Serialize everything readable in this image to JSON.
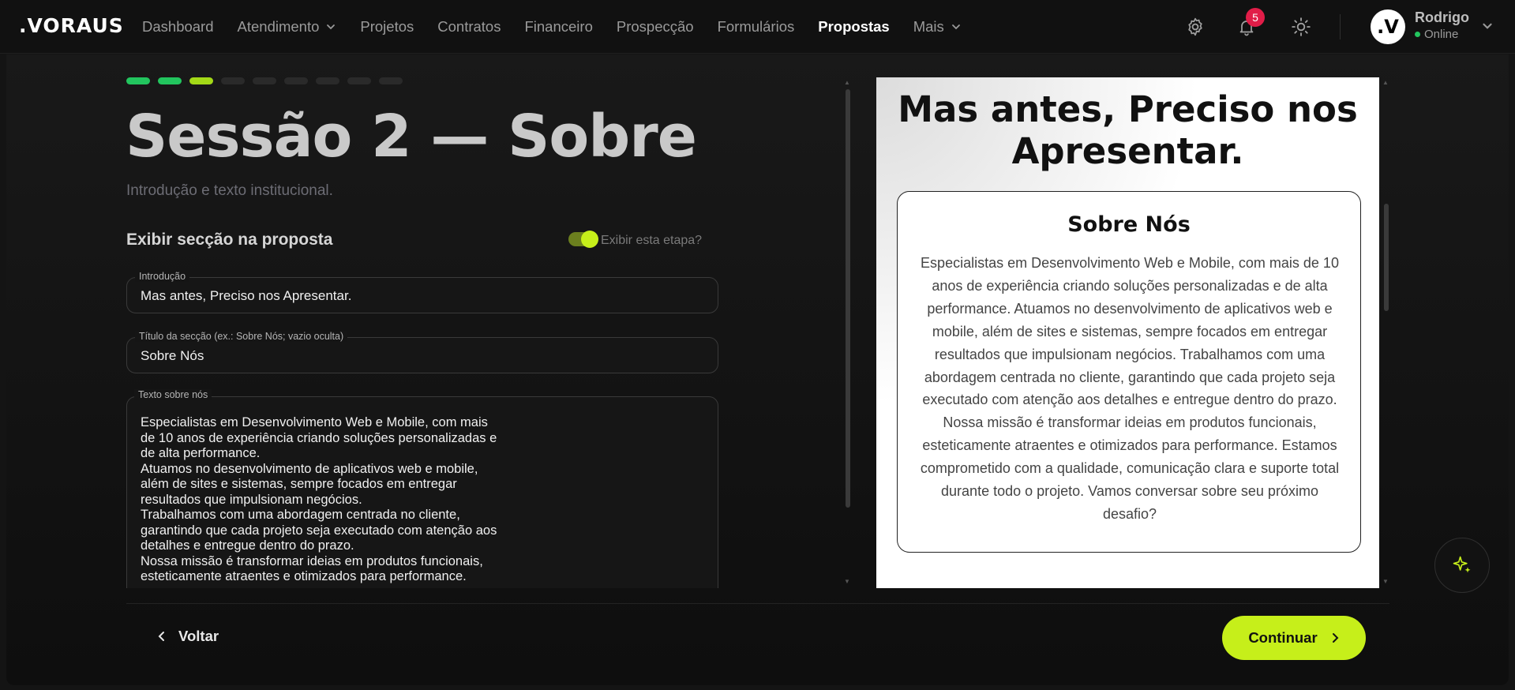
{
  "app": {
    "logo": ".VORAUS"
  },
  "nav": {
    "items": [
      {
        "label": "Dashboard",
        "dropdown": false,
        "active": false
      },
      {
        "label": "Atendimento",
        "dropdown": true,
        "active": false
      },
      {
        "label": "Projetos",
        "dropdown": false,
        "active": false
      },
      {
        "label": "Contratos",
        "dropdown": false,
        "active": false
      },
      {
        "label": "Financeiro",
        "dropdown": false,
        "active": false
      },
      {
        "label": "Prospecção",
        "dropdown": false,
        "active": false
      },
      {
        "label": "Formulários",
        "dropdown": false,
        "active": false
      },
      {
        "label": "Propostas",
        "dropdown": false,
        "active": true
      },
      {
        "label": "Mais",
        "dropdown": true,
        "active": false
      }
    ],
    "notification_count": "5",
    "user": {
      "avatar": ".V",
      "name": "Rodrigo",
      "status": "Online"
    }
  },
  "progress": {
    "total_steps": 9,
    "completed_steps": 2,
    "current_step": 3
  },
  "section": {
    "title": "Sessão 2 — Sobre",
    "subtitle": "Introdução e texto institucional.",
    "display_label": "Exibir secção na proposta",
    "toggle_label": "Exibir esta etapa?",
    "toggle_on": true
  },
  "form": {
    "intro": {
      "legend": "Introdução",
      "value": "Mas antes, Preciso nos Apresentar."
    },
    "section_title": {
      "legend": "Título da secção (ex.: Sobre Nós; vazio oculta)",
      "value": "Sobre Nós"
    },
    "about_text": {
      "legend": "Texto sobre nós",
      "value": "Especialistas em Desenvolvimento Web e Mobile, com mais de 10 anos de experiência criando soluções personalizadas e de alta performance.\nAtuamos no desenvolvimento de aplicativos web e mobile, além de sites e sistemas, sempre focados em entregar resultados que impulsionam negócios.\nTrabalhamos com uma abordagem centrada no cliente, garantindo que cada projeto seja executado com atenção aos detalhes e entregue dentro do prazo.\nNossa missão é transformar ideias em produtos funcionais, esteticamente atraentes e otimizados para performance."
    }
  },
  "preview": {
    "heading": "Mas antes, Preciso nos Apresentar.",
    "card_title": "Sobre Nós",
    "card_text": "Especialistas em Desenvolvimento Web e Mobile, com mais de 10 anos de experiência criando soluções personalizadas e de alta performance. Atuamos no desenvolvimento de aplicativos web e mobile, além de sites e sistemas, sempre focados em entregar resultados que impulsionam negócios. Trabalhamos com uma abordagem centrada no cliente, garantindo que cada projeto seja executado com atenção aos detalhes e entregue dentro do prazo. Nossa missão é transformar ideias em produtos funcionais, esteticamente atraentes e otimizados para performance. Estamos comprometido com a qualidade, comunicação clara e suporte total durante todo o projeto. Vamos conversar sobre seu próximo desafio?"
  },
  "footer": {
    "back_label": "Voltar",
    "continue_label": "Continuar"
  },
  "colors": {
    "accent": "#c6ef1a",
    "step_done": "#22c55e",
    "step_current": "#a3d917",
    "badge": "#e11d48"
  },
  "icons": {
    "settings": "gear-icon",
    "notifications": "bell-icon",
    "theme": "sun-icon",
    "assistant": "sparkle-icon"
  }
}
